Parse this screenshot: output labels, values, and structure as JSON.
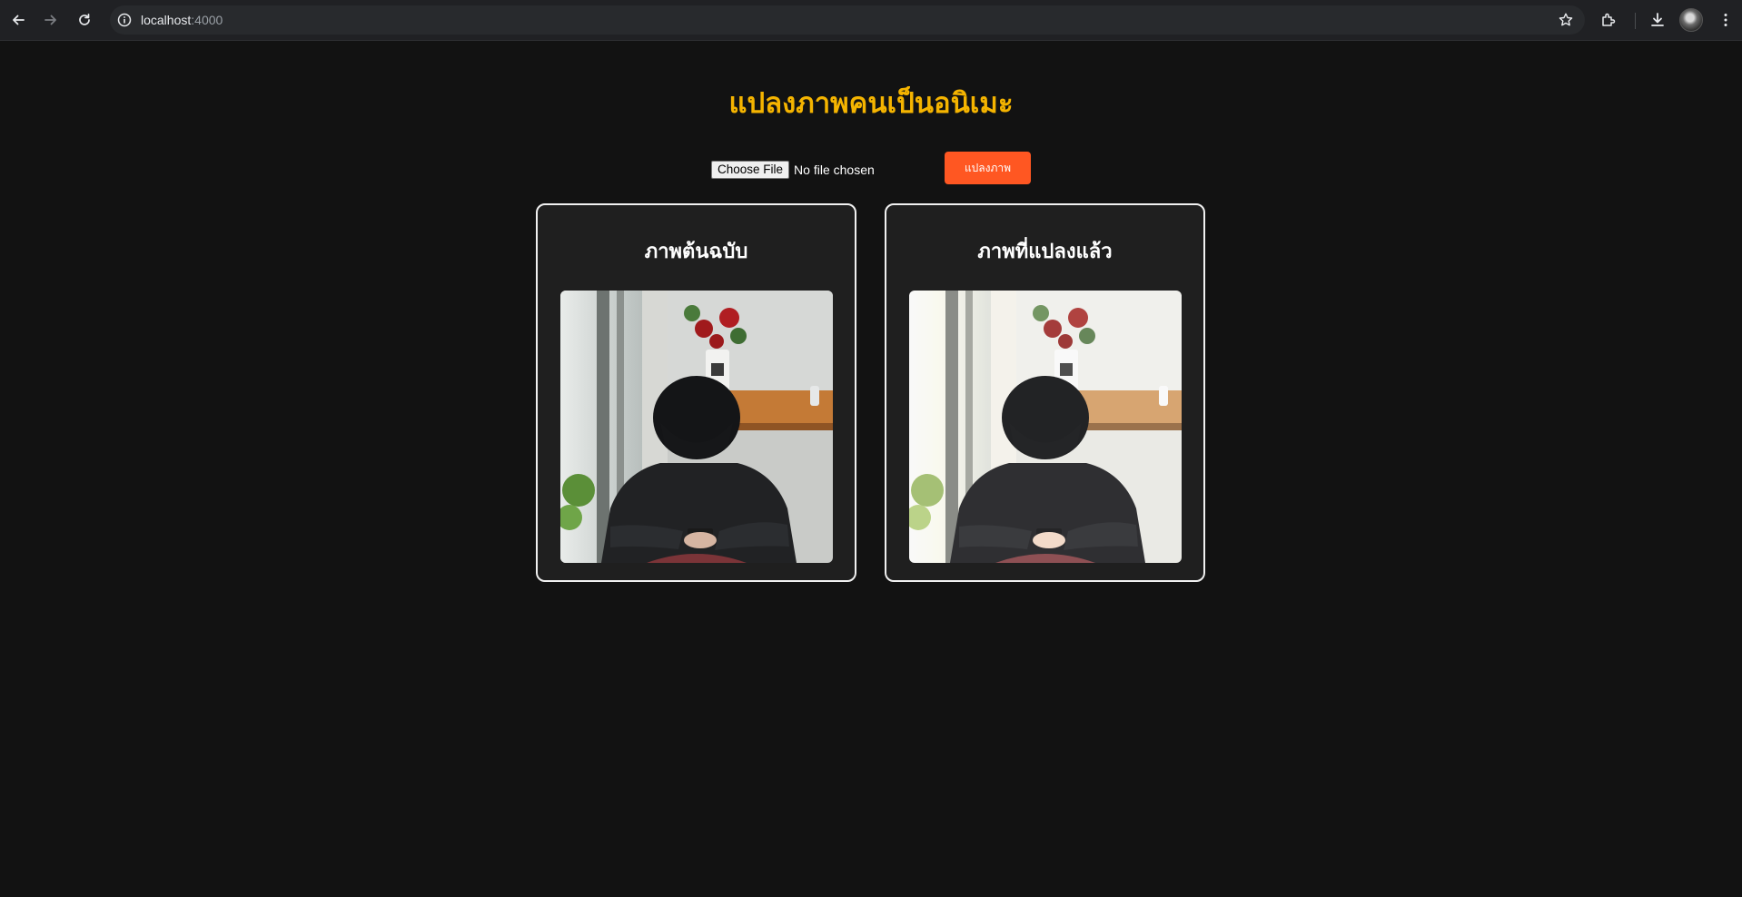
{
  "browser": {
    "url_host": "localhost",
    "url_port": ":4000",
    "icons": [
      "back-icon",
      "forward-icon",
      "reload-icon",
      "info-icon",
      "star-icon",
      "extensions-icon",
      "download-icon",
      "menu-icon"
    ]
  },
  "page": {
    "title": "แปลงภาพคนเป็นอนิเมะ",
    "file_input": {
      "button_label": "Choose File",
      "status": "No file chosen"
    },
    "convert_label": "แปลงภาพ",
    "cards": {
      "original_title": "ภาพต้นฉบับ",
      "converted_title": "ภาพที่แปลงแล้ว"
    }
  },
  "colors": {
    "background": "#121212",
    "title": "#f5b400",
    "accent_button": "#ff5722",
    "card_border": "#f1f1f1"
  }
}
